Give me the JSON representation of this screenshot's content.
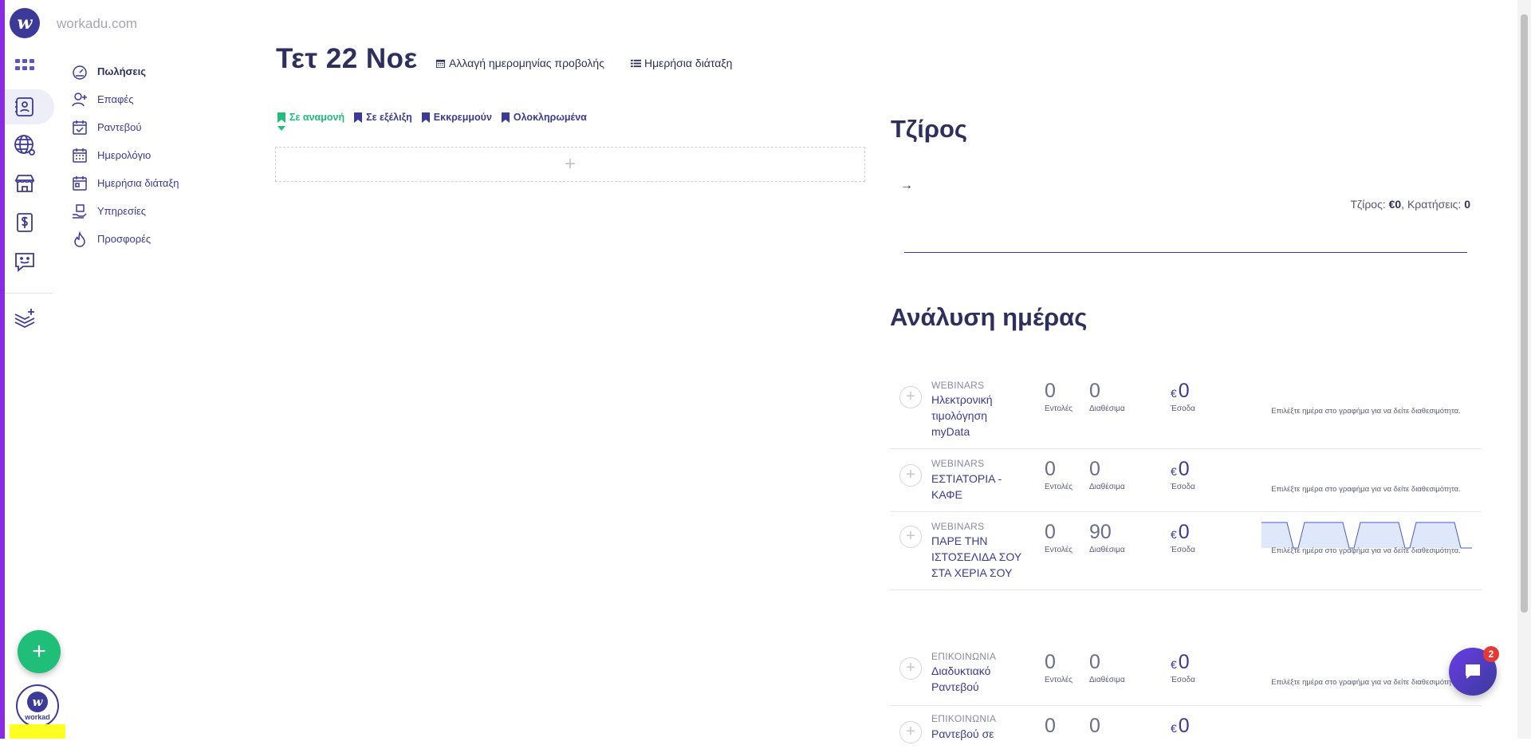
{
  "brand": {
    "logo_letter": "w",
    "site": "workadu.com",
    "avatar_text": "workad"
  },
  "nav": {
    "items": [
      {
        "label": "Πωλήσεις",
        "active": true,
        "icon": "speedometer-icon"
      },
      {
        "label": "Επαφές",
        "active": false,
        "icon": "user-plus-icon"
      },
      {
        "label": "Ραντεβού",
        "active": false,
        "icon": "calendar-check-icon"
      },
      {
        "label": "Ημερολόγιο",
        "active": false,
        "icon": "calendar-grid-icon"
      },
      {
        "label": "Ημερήσια διάταξη",
        "active": false,
        "icon": "calendar-day-icon"
      },
      {
        "label": "Υπηρεσίες",
        "active": false,
        "icon": "service-hand-icon"
      },
      {
        "label": "Προσφορές",
        "active": false,
        "icon": "flame-icon"
      }
    ]
  },
  "header": {
    "date_title": "Τετ 22 Νοε",
    "change_date_label": "Αλλαγή ημερομηνίας προβολής",
    "daily_agenda_label": "Ημερήσια διάταξη"
  },
  "tabs": [
    {
      "label": "Σε αναμονή",
      "active": true
    },
    {
      "label": "Σε εξέλιξη",
      "active": false
    },
    {
      "label": "Εκκρεμμούν",
      "active": false
    },
    {
      "label": "Ολοκληρωμένα",
      "active": false
    }
  ],
  "add_box_symbol": "+",
  "revenue": {
    "title": "Τζίρος",
    "arrow": "→",
    "summary_prefix": "Τζίρος:",
    "summary_value": "€0",
    "bookings_prefix": "Κρατήσεις:",
    "bookings_value": "0"
  },
  "day_analysis": {
    "title": "Ανάλυση ημέρας",
    "labels": {
      "orders": "Εντολές",
      "available": "Διαθέσιμα",
      "income": "Έσοδα"
    },
    "currency": "€",
    "hint": "Επιλέξτε ημέρα στο γραφήμα για να δείτε διαθεσιμότητα.",
    "rows": [
      {
        "category": "WEBINARS",
        "name": "Ηλεκτρονική τιμολόγηση myData",
        "orders": "0",
        "available": "0",
        "income": "0",
        "sparkline": false
      },
      {
        "category": "WEBINARS",
        "name": "ΕΣΤΙΑΤΟΡΙΑ - ΚΑΦΕ",
        "orders": "0",
        "available": "0",
        "income": "0",
        "sparkline": false
      },
      {
        "category": "WEBINARS",
        "name": "ΠΑΡΕ ΤΗΝ ΙΣΤΟΣΕΛΙΔΑ ΣΟΥ ΣΤΑ ΧΕΡΙΑ ΣΟΥ",
        "orders": "0",
        "available": "90",
        "income": "0",
        "sparkline": true
      },
      {
        "category": "ΕΠΙΚΟΙΝΩΝΙΑ",
        "name": "Διαδυκτιακό Ραντεβού",
        "orders": "0",
        "available": "0",
        "income": "0",
        "sparkline": false
      },
      {
        "category": "ΕΠΙΚΟΙΝΩΝΙΑ",
        "name": "Ραντεβού σε",
        "orders": "0",
        "available": "0",
        "income": "0",
        "sparkline": false
      }
    ]
  },
  "chat": {
    "badge": "2"
  },
  "colors": {
    "primary": "#3b3a99",
    "accent": "#8a2be2",
    "success": "#1fbf7a",
    "badge": "#e53935"
  }
}
